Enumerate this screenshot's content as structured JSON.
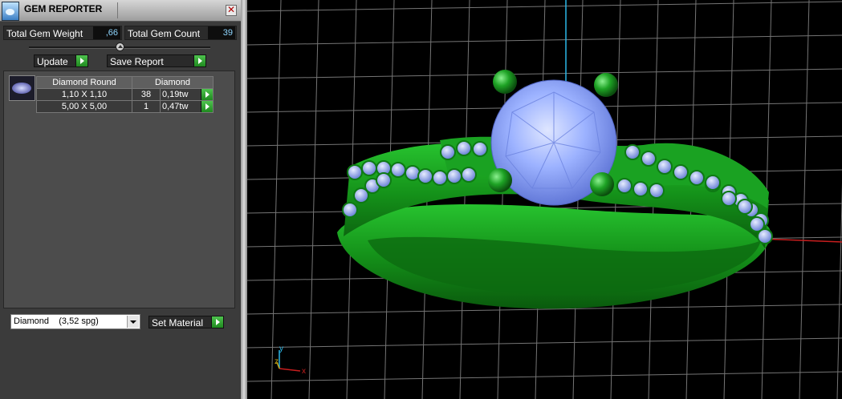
{
  "panel": {
    "title": "GEM REPORTER",
    "close_symbol": "✕",
    "total_weight_label": "Total Gem Weight",
    "total_weight_value": ",66",
    "total_count_label": "Total Gem Count",
    "total_count_value": "39",
    "update_label": "Update",
    "save_report_label": "Save Report",
    "table_headers": [
      "Diamond Round",
      "Diamond"
    ],
    "rows": [
      {
        "size": "1,10 X 1,10",
        "count": "38",
        "weight": "0,19tw"
      },
      {
        "size": "5,00 X 5,00",
        "count": "1",
        "weight": "0,47tw"
      }
    ],
    "material_value": "Diamond    (3,52 spg)",
    "set_material_label": "Set Material"
  },
  "viewport": {
    "axis_y": "y",
    "axis_z": "z",
    "axis_x": "x",
    "colors": {
      "metal": "#22a52a",
      "gem": "#8fa8ff",
      "grid": "#8a8a8a",
      "axis_blue": "#2bb7e8",
      "axis_red": "#c81e1e"
    }
  }
}
